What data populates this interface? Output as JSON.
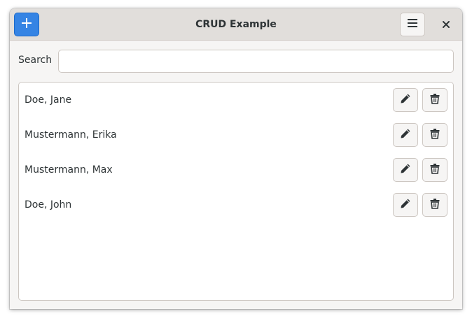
{
  "window": {
    "title": "CRUD Example",
    "accent_color": "#3584e4"
  },
  "header": {
    "add_icon": "plus-icon",
    "menu_icon": "hamburger-menu-icon",
    "close_icon": "close-icon"
  },
  "search": {
    "label": "Search",
    "value": "",
    "placeholder": ""
  },
  "list": {
    "items": [
      {
        "name": "Doe, Jane",
        "edit_icon": "pencil-icon",
        "delete_icon": "trash-icon"
      },
      {
        "name": "Mustermann, Erika",
        "edit_icon": "pencil-icon",
        "delete_icon": "trash-icon"
      },
      {
        "name": "Mustermann, Max",
        "edit_icon": "pencil-icon",
        "delete_icon": "trash-icon"
      },
      {
        "name": "Doe, John",
        "edit_icon": "pencil-icon",
        "delete_icon": "trash-icon"
      }
    ]
  }
}
